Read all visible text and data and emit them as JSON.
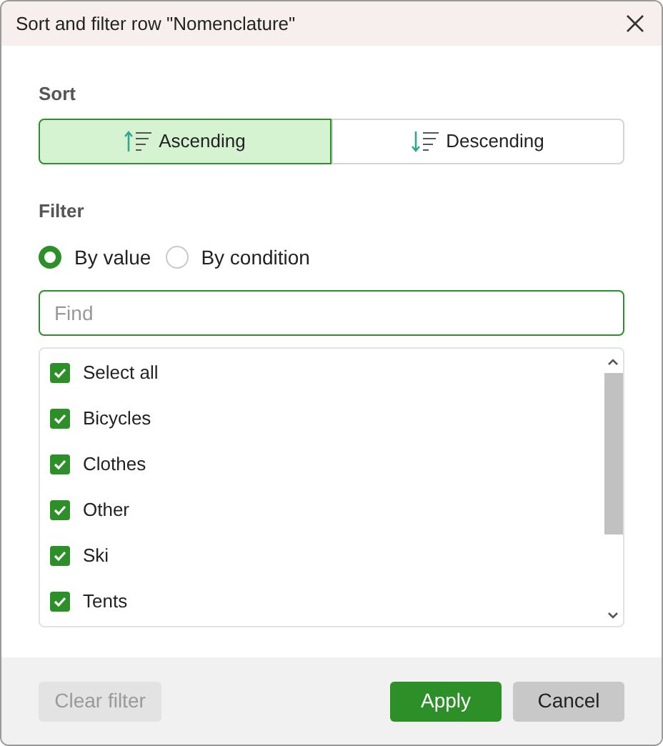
{
  "window": {
    "title": "Sort and filter row \"Nomenclature\""
  },
  "sort": {
    "label": "Sort",
    "options": [
      {
        "label": "Ascending",
        "kind": "ascending",
        "selected": true
      },
      {
        "label": "Descending",
        "kind": "descending",
        "selected": false
      }
    ]
  },
  "filter": {
    "label": "Filter",
    "modes": [
      {
        "label": "By value",
        "selected": true
      },
      {
        "label": "By condition",
        "selected": false
      }
    ],
    "search": {
      "placeholder": "Find"
    },
    "items": [
      {
        "label": "Select all",
        "checked": true
      },
      {
        "label": "Bicycles",
        "checked": true
      },
      {
        "label": "Clothes",
        "checked": true
      },
      {
        "label": "Other",
        "checked": true
      },
      {
        "label": "Ski",
        "checked": true
      },
      {
        "label": "Tents",
        "checked": true
      }
    ]
  },
  "footer": {
    "buttons": [
      {
        "label": "Clear filter",
        "kind": "clear",
        "disabled": true
      },
      {
        "label": "Apply",
        "kind": "primary",
        "disabled": false
      },
      {
        "label": "Cancel",
        "kind": "secondary",
        "disabled": false
      }
    ]
  }
}
